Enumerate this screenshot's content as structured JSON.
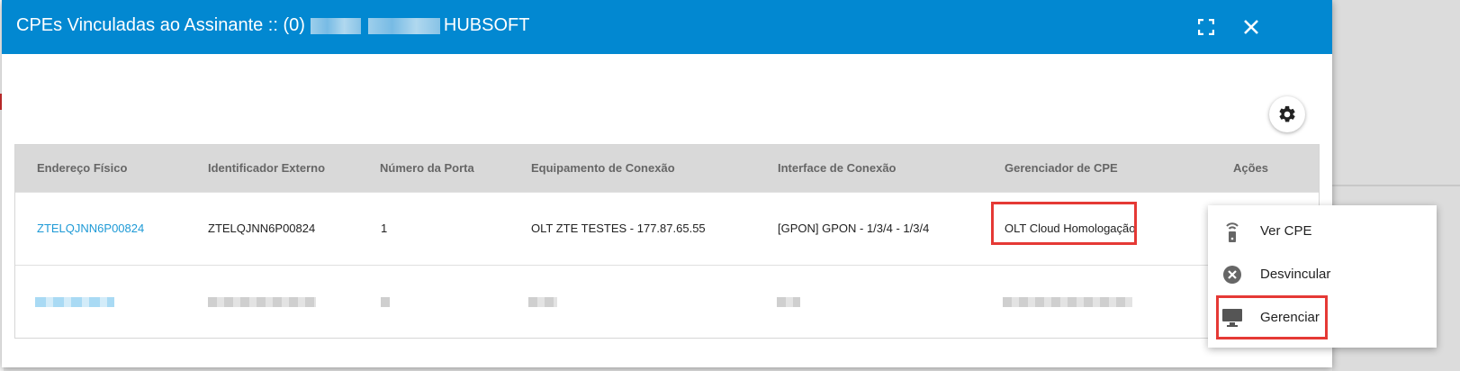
{
  "dialog": {
    "title_prefix": "CPEs Vinculadas ao Assinante :: (0)",
    "title_suffix": "HUBSOFT",
    "fullscreen_icon": "fullscreen-icon",
    "close_icon": "close-icon",
    "settings_icon": "gear-icon",
    "colors": {
      "header": "#0288d1",
      "link": "#1e9ad6",
      "highlight": "#e53935"
    }
  },
  "table": {
    "headers": [
      "Endereço Físico",
      "Identificador Externo",
      "Número da Porta",
      "Equipamento de Conexão",
      "Interface de Conexão",
      "Gerenciador de CPE",
      "Ações"
    ],
    "rows": [
      {
        "endereco": "ZTELQJNN6P00824",
        "identificador": "ZTELQJNN6P00824",
        "porta": "1",
        "equipamento": "OLT ZTE TESTES - 177.87.65.55",
        "interface": "[GPON] GPON - 1/3/4 - 1/3/4",
        "gerenciador": "OLT Cloud Homologação"
      }
    ]
  },
  "menu": {
    "items": [
      {
        "label": "Ver CPE",
        "icon": "router-icon"
      },
      {
        "label": "Desvincular",
        "icon": "cancel-circle-icon"
      },
      {
        "label": "Gerenciar",
        "icon": "monitor-icon"
      }
    ]
  }
}
